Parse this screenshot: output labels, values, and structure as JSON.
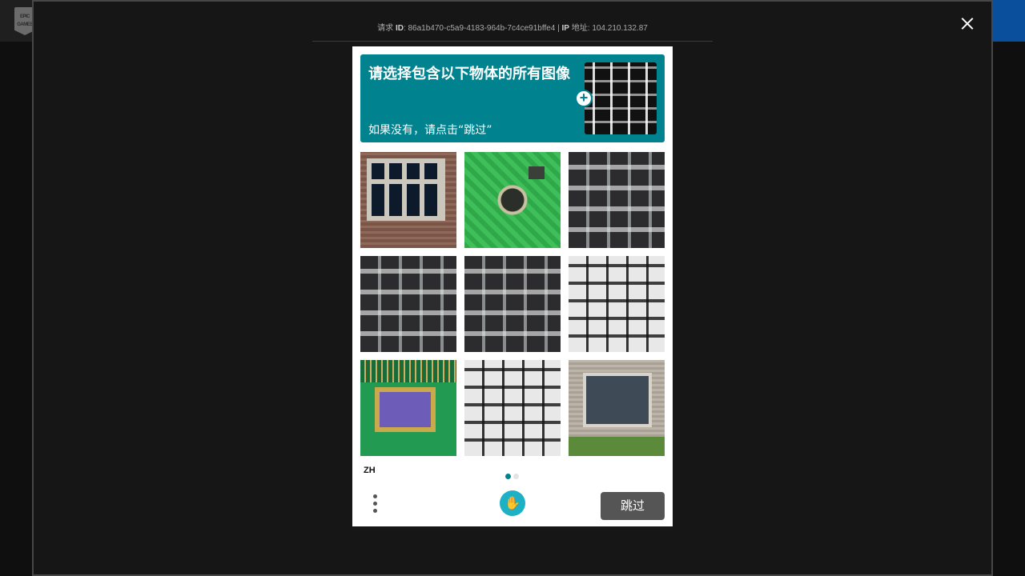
{
  "background": {
    "logo_text": "EPIC GAMES"
  },
  "overlay": {
    "ray_label_prefix": "请求",
    "ray_id_label": "ID",
    "ray_id": "86a1b470-c5a9-4183-964b-7c4ce91bffe4",
    "ip_label": "IP",
    "ip_suffix": "地址",
    "ip": "104.210.132.87"
  },
  "captcha": {
    "title": "请选择包含以下物体的所有图像",
    "subtitle": "如果没有，请点击“跳过”",
    "example_icon": "keyboard-example",
    "tiles": [
      {
        "name": "window",
        "icon": "window-image"
      },
      {
        "name": "circuit-board",
        "icon": "circuit-board-image"
      },
      {
        "name": "keyboard",
        "icon": "keyboard-image"
      },
      {
        "name": "keyboard",
        "icon": "keyboard-image"
      },
      {
        "name": "keyboard",
        "icon": "keyboard-image"
      },
      {
        "name": "keyboard",
        "icon": "keyboard-image"
      },
      {
        "name": "circuit-chip",
        "icon": "chip-image"
      },
      {
        "name": "keyboard",
        "icon": "keyboard-image"
      },
      {
        "name": "building-window",
        "icon": "building-image"
      }
    ],
    "language": "ZH",
    "page_dots": [
      {
        "color": "#00838f"
      },
      {
        "color": "#e3e3e3"
      }
    ],
    "skip_label": "跳过"
  },
  "colors": {
    "accent": "#00838f",
    "skip_button": "#555555"
  }
}
